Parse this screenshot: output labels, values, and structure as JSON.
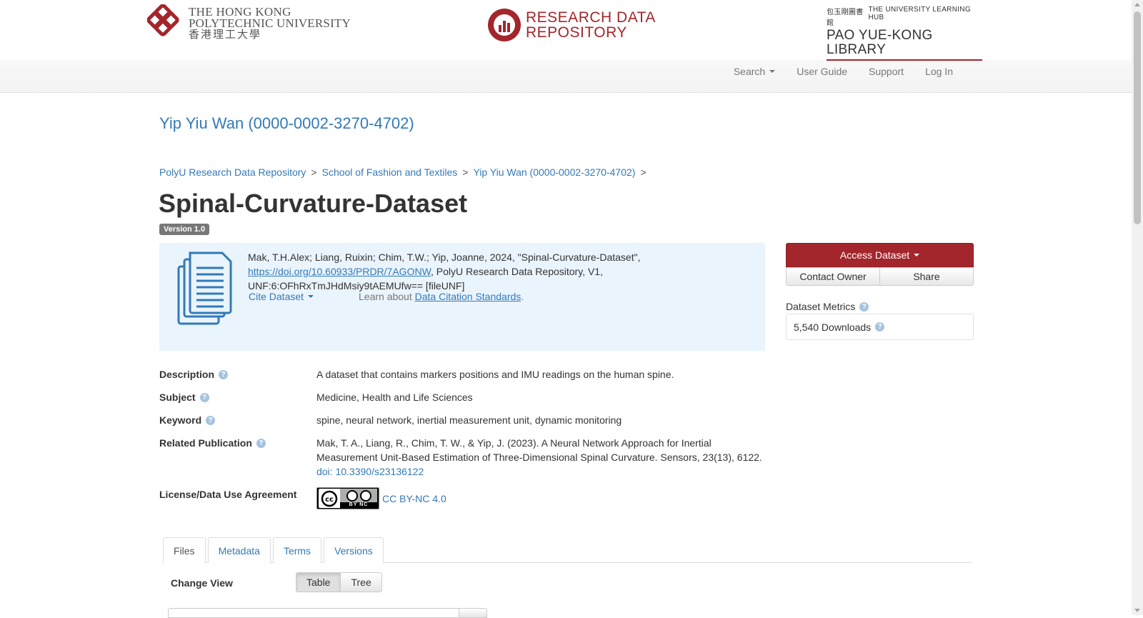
{
  "header": {
    "polyu_logo": {
      "line1": "THE HONG KONG",
      "line2": "POLYTECHNIC UNIVERSITY",
      "line3": "香港理工大學"
    },
    "rdr_logo": {
      "line1": "RESEARCH DATA",
      "line2": "REPOSITORY"
    },
    "library_logo": {
      "chinese": "包玉剛圖書館",
      "tagline": "THE UNIVERSITY LEARNING HUB",
      "name": "PAO YUE-KONG LIBRARY"
    },
    "nav": {
      "search": "Search",
      "user_guide": "User Guide",
      "support": "Support",
      "login": "Log In"
    }
  },
  "dataverse_name": "Yip Yiu Wan (0000-0002-3270-4702)",
  "breadcrumb": {
    "items": [
      "PolyU Research Data Repository",
      "School of Fashion and Textiles",
      "Yip Yiu Wan (0000-0002-3270-4702)"
    ],
    "separator": ">"
  },
  "dataset": {
    "title": "Spinal-Curvature-Dataset",
    "version": "Version 1.0"
  },
  "citation": {
    "prefix": "Mak, T.H.Alex; Liang, Ruixin; Chim, T.W.; Yip, Joanne, 2024, \"Spinal-Curvature-Dataset\", ",
    "doi_link": "https://doi.org/10.60933/PRDR/7AGONW",
    "suffix": ", PolyU Research Data Repository, V1, UNF:6:OFhRxTmJHdMsiy9tAEMUfw== [fileUNF]",
    "cite_dropdown": "Cite Dataset",
    "learn_prefix": "Learn about ",
    "learn_link": "Data Citation Standards",
    "learn_suffix": "."
  },
  "sidebar": {
    "access_button": "Access Dataset",
    "contact_button": "Contact Owner",
    "share_button": "Share",
    "metrics_label": "Dataset Metrics",
    "downloads": "5,540 Downloads"
  },
  "metadata": {
    "description_label": "Description",
    "description": "A dataset that contains markers positions and IMU readings on the human spine.",
    "subject_label": "Subject",
    "subject": "Medicine, Health and Life Sciences",
    "keyword_label": "Keyword",
    "keyword": "spine, neural network, inertial measurement unit, dynamic monitoring",
    "related_pub_label": "Related Publication",
    "related_pub": "Mak, T. A., Liang, R., Chim, T. W., & Yip, J. (2023). A Neural Network Approach for Inertial Measurement Unit-Based Estimation of Three-Dimensional Spinal Curvature. Sensors, 23(13), 6122.",
    "related_pub_doi": "doi: 10.3390/s23136122",
    "license_label": "License/Data Use Agreement",
    "license": "CC BY-NC 4.0",
    "license_badge_text": "BY NC"
  },
  "tabs": [
    "Files",
    "Metadata",
    "Terms",
    "Versions"
  ],
  "files": {
    "change_view_label": "Change View",
    "view_options": [
      "Table",
      "Tree"
    ]
  },
  "colors": {
    "brand_red": "#a3262c",
    "link_blue": "#337ab7",
    "citation_bg": "#eaf4fc",
    "help_icon": "#a5c3e0"
  },
  "icons": {
    "help": "question-circle-icon",
    "citation": "documents-stack-icon",
    "license": "cc-by-nc-badge-icon"
  }
}
